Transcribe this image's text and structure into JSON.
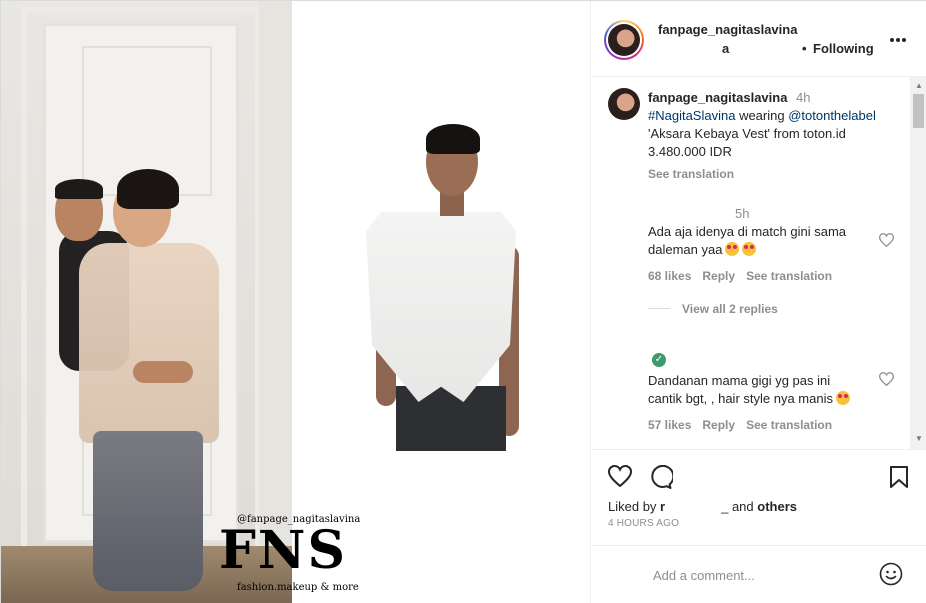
{
  "header": {
    "username": "fanpage_nagitaslavina",
    "sub_partial": "a",
    "separator": "•",
    "following_label": "Following",
    "more_icon": "more-icon"
  },
  "caption": {
    "username": "fanpage_nagitaslavina",
    "time": "4h",
    "hashtag": "#NagitaSlavina",
    "text_wearing": " wearing ",
    "mention": "@totonthelabel",
    "line2": "'Aksara Kebaya Vest' from toton.id",
    "line3": "3.480.000 IDR",
    "see_translation": "See translation"
  },
  "comments": [
    {
      "time": "5h",
      "text_line1": "Ada aja idenya di match gini sama",
      "text_line2": "daleman yaa",
      "likes": "68 likes",
      "reply": "Reply",
      "see_translation": "See translation",
      "view_replies": "View all 2 replies"
    },
    {
      "text_line1": "Dandanan mama gigi yg pas ini",
      "text_line2": "cantik bgt, , hair style nya manis",
      "likes": "57 likes",
      "reply": "Reply",
      "see_translation": "See translation"
    }
  ],
  "actions": {
    "liked_by_prefix": "Liked by ",
    "liked_by_partial": "r",
    "liked_by_suffix_sep": "_",
    "liked_by_and": " and ",
    "liked_by_others": "others",
    "time_ago": "4 HOURS AGO"
  },
  "comment_box": {
    "placeholder": "Add a comment..."
  },
  "media": {
    "watermark_handle": "@fanpage_nagitaslavina",
    "watermark_logo": "FNS",
    "watermark_tagline": "fashion.makeup & more"
  },
  "colors": {
    "link": "#00376b",
    "muted": "#8e8e8e",
    "text": "#262626",
    "verified": "#3e9b6b"
  }
}
